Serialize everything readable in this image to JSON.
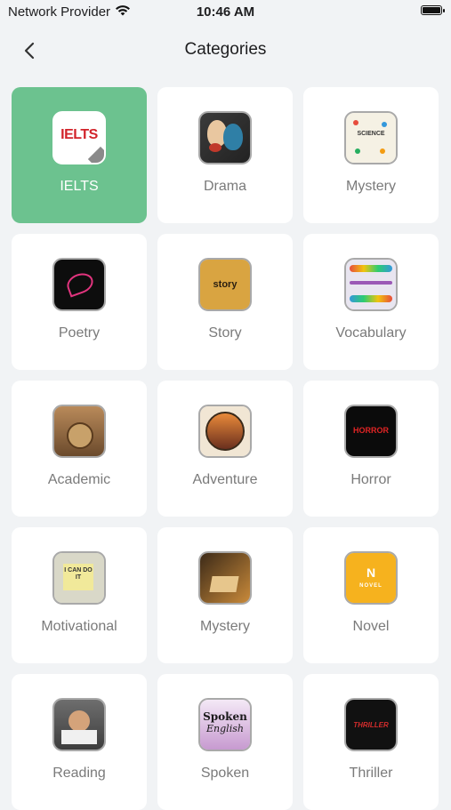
{
  "status_bar": {
    "carrier": "Network Provider",
    "time": "10:46 AM"
  },
  "nav": {
    "title": "Categories"
  },
  "image_text": {
    "ielts": "IELTS",
    "science": "SCIENCE",
    "story": "story",
    "horror": "HORROR",
    "motivational": "I CAN DO IT",
    "novel_mark": "N",
    "novel": "NOVEL",
    "spoken_1": "Spoken",
    "spoken_2": "English",
    "thriller": "THRILLER"
  },
  "categories": [
    {
      "label": "IELTS",
      "selected": true
    },
    {
      "label": "Drama"
    },
    {
      "label": "Mystery"
    },
    {
      "label": "Poetry"
    },
    {
      "label": "Story"
    },
    {
      "label": "Vocabulary"
    },
    {
      "label": "Academic"
    },
    {
      "label": "Adventure"
    },
    {
      "label": "Horror"
    },
    {
      "label": "Motivational"
    },
    {
      "label": "Mystery"
    },
    {
      "label": "Novel"
    },
    {
      "label": "Reading"
    },
    {
      "label": "Spoken"
    },
    {
      "label": "Thriller"
    }
  ],
  "colors": {
    "selected_card": "#6cc28f",
    "background": "#f1f3f5",
    "card": "#ffffff"
  }
}
